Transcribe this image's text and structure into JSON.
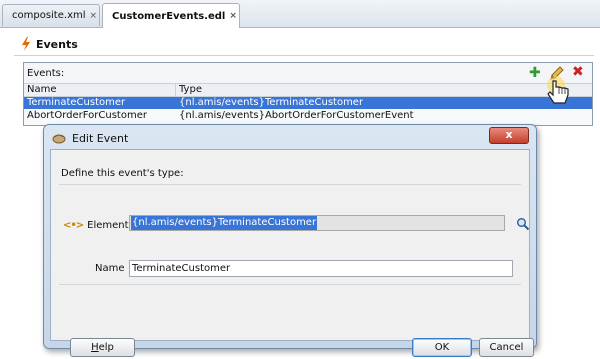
{
  "tabs": [
    {
      "label": "composite.xml",
      "close": "×"
    },
    {
      "label": "CustomerEvents.edl",
      "close": "×"
    }
  ],
  "panel": {
    "title": "Events",
    "box_label": "Events:",
    "add_glyph": "✚",
    "delete_glyph": "✖",
    "columns": [
      "Name",
      "Type"
    ],
    "rows": [
      {
        "name": "TerminateCustomer",
        "type": "{nl.amis/events}TerminateCustomer",
        "selected": true
      },
      {
        "name": "AbortOrderForCustomer",
        "type": "{nl.amis/events}AbortOrderForCustomerEvent",
        "selected": false
      }
    ]
  },
  "dialog": {
    "title": "Edit Event",
    "close_glyph": "x",
    "define_label": "Define this event's type:",
    "element_label": "Element",
    "element_value": "{nl.amis/events}TerminateCustomer",
    "name_label": "Name",
    "name_value": "TerminateCustomer",
    "help_label_u": "H",
    "help_label_rest": "elp",
    "ok_label": "OK",
    "cancel_label": "Cancel"
  },
  "icons": {
    "event_icon": "lightning-bolt-icon",
    "xml_icon": "composite-icon",
    "edit_icon": "pencil-icon",
    "search_icon": "magnifier-icon"
  },
  "colors": {
    "selection": "#3875d7",
    "add": "#2e9b2e",
    "delete": "#cc2222",
    "bolt": "#e06a00"
  }
}
